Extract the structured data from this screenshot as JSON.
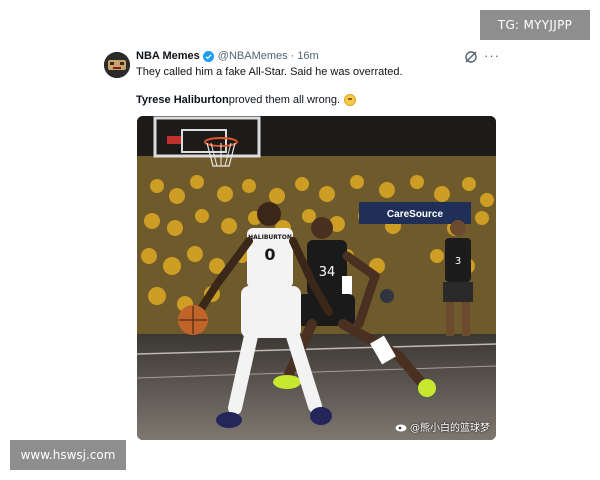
{
  "overlays": {
    "tg_label": "TG: MYYJJPP",
    "site_label": "www.hswsj.com"
  },
  "tweet": {
    "display_name": "NBA Memes",
    "handle": "@NBAMemes",
    "separator": "·",
    "time": "16m",
    "more_label": "···",
    "line1": "They called him a fake All-Star. Said he was overrated.",
    "line2_bold": "Tyrese Haliburton",
    "line2_rest": " proved them all wrong.",
    "emoji_name": "grinning-face-emoji",
    "media": {
      "jersey_front_name": "HALIBURTON",
      "jersey_front_number": "0",
      "defender_number": "34",
      "background_number": "3",
      "court_ad": "CareSource",
      "watermark": "@熊小白的篮球梦"
    }
  },
  "colors": {
    "verified": "#1d9bf0",
    "text_primary": "#0f1419",
    "text_secondary": "#536471",
    "badge_bg": "#8e8e8e",
    "crowd_gold": "#d8a524"
  }
}
